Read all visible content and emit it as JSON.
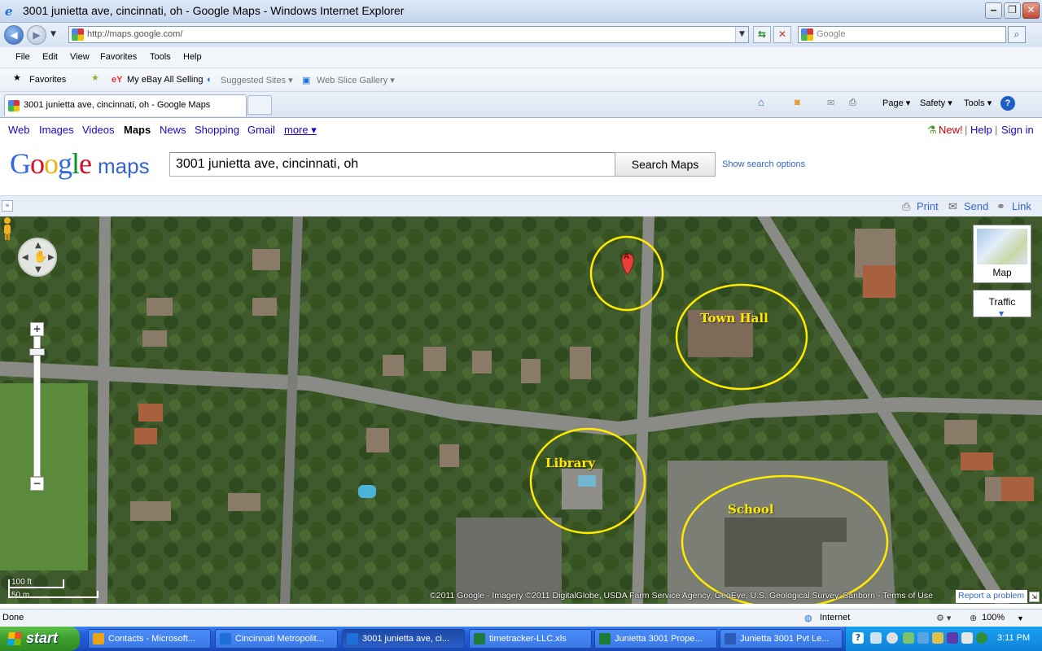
{
  "window": {
    "title": "3001 junietta ave, cincinnati, oh - Google Maps - Windows Internet Explorer",
    "min": "‒",
    "max": "❐",
    "close": "✕"
  },
  "address_bar": {
    "url": "http://maps.google.com/",
    "search_placeholder": "Google"
  },
  "menu": [
    "File",
    "Edit",
    "View",
    "Favorites",
    "Tools",
    "Help"
  ],
  "favorites_bar": {
    "favorites": "Favorites",
    "ebay": "My eBay All Selling",
    "suggested": "Suggested Sites ▾",
    "webslice": "Web Slice Gallery ▾"
  },
  "tab": {
    "title": "3001 junietta ave, cincinnati, oh - Google Maps"
  },
  "command_bar": {
    "page": "Page ▾",
    "safety": "Safety ▾",
    "tools": "Tools ▾",
    "help": "?"
  },
  "google_bar": {
    "links": [
      "Web",
      "Images",
      "Videos",
      "Maps",
      "News",
      "Shopping",
      "Gmail"
    ],
    "more": "more ▾",
    "new": "New!",
    "help": "Help",
    "signin": "Sign in",
    "sep": "|"
  },
  "search": {
    "value": "3001 junietta ave, cincinnati, oh",
    "button": "Search Maps",
    "options": "Show search options"
  },
  "logo": {
    "google": [
      "G",
      "o",
      "o",
      "g",
      "l",
      "e"
    ],
    "colors": [
      "#3369e8",
      "#d50f25",
      "#eeb211",
      "#3369e8",
      "#009925",
      "#d50f25"
    ],
    "maps": "maps"
  },
  "strip": {
    "print": "Print",
    "send": "Send",
    "link": "Link"
  },
  "map": {
    "marker": "A",
    "annotations": {
      "town_hall": "Town Hall",
      "library": "Library",
      "school": "School"
    },
    "annotation_color": "#ffea00",
    "map_type": "Map",
    "traffic": "Traffic",
    "scale_ft": "100 ft",
    "scale_m": "50 m",
    "copyright": "©2011 Google - Imagery ©2011 DigitalGlobe, USDA Farm Service Agency, GeoEye, U.S. Geological Survey, Sanborn - Terms of Use",
    "report": "Report a problem"
  },
  "status_bar": {
    "text": "Done",
    "zone": "Internet",
    "zoom": "100%"
  },
  "taskbar": {
    "start": "start",
    "buttons": [
      {
        "label": "Contacts - Microsoft...",
        "color": "#e8a317"
      },
      {
        "label": "Cincinnati Metropolit...",
        "color": "#1e6fd9"
      },
      {
        "label": "3001 junietta ave, ci...",
        "color": "#1e6fd9"
      },
      {
        "label": "timetracker-LLC.xls",
        "color": "#1d7a3a"
      },
      {
        "label": "Junietta 3001 Prope...",
        "color": "#1d7a3a"
      },
      {
        "label": "Junietta 3001 Pvt Le...",
        "color": "#2b5cb8"
      }
    ],
    "clock": "3:11 PM"
  }
}
